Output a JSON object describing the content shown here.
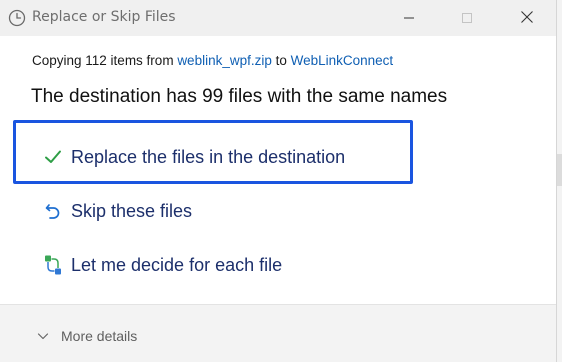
{
  "window": {
    "title": "Replace or Skip Files",
    "icon": "clock-icon",
    "controls": [
      "minimize-icon",
      "maximize-icon",
      "close-icon"
    ]
  },
  "summary": {
    "prefix": "Copying 112 items from ",
    "source": "weblink_wpf.zip",
    "middle": " to ",
    "destination": "WebLinkConnect"
  },
  "heading": "The destination has 99 files with the same names",
  "options": [
    {
      "label": "Replace the files in the destination",
      "icon": "checkmark-icon",
      "focused": true
    },
    {
      "label": "Skip these files",
      "icon": "undo-arrow-icon"
    },
    {
      "label": "Let me decide for each file",
      "icon": "compare-files-icon"
    }
  ],
  "footer": {
    "more_details": "More details",
    "icon": "chevron-down-icon"
  },
  "colors": {
    "link": "#0f5fb3",
    "option_text": "#1c2f6b",
    "focus_border": "#1a55e0",
    "check_green": "#2e9e46",
    "titlebar_bg": "#f0f0f0",
    "footer_bg": "#f3f3f3"
  }
}
